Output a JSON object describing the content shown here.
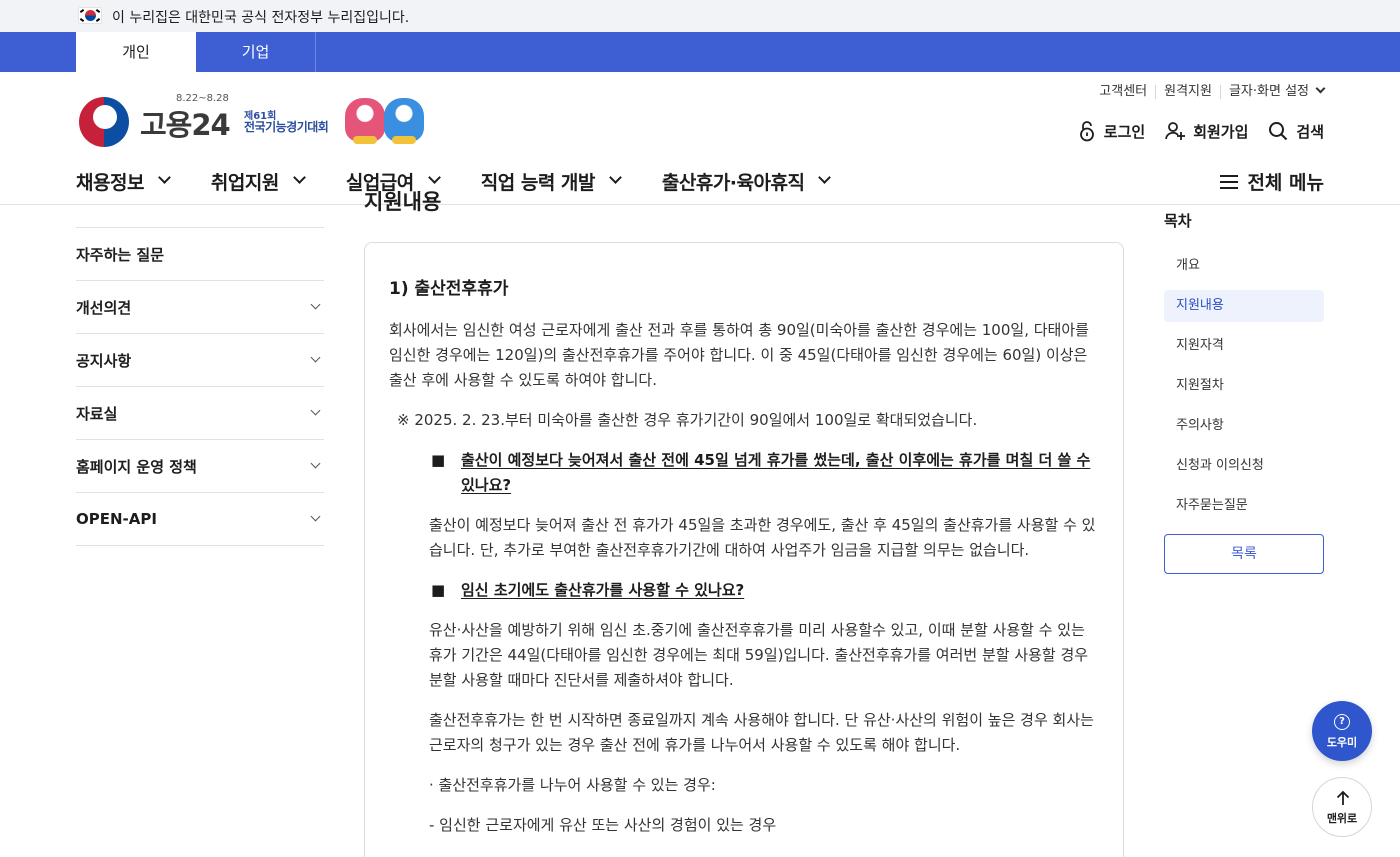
{
  "gov_banner": {
    "text": "이 누리집은 대한민국 공식 전자정부 누리집입니다."
  },
  "user_tabs": [
    {
      "label": "개인",
      "active": true
    },
    {
      "label": "기업",
      "active": false
    }
  ],
  "logo": {
    "name": "고용24",
    "date": "8.22~8.28",
    "event_line1": "제61회",
    "event_line2": "전국기능경기대회"
  },
  "util_links": [
    "고객센터",
    "원격지원",
    "글자·화면 설정"
  ],
  "member_links": {
    "login": "로그인",
    "signup": "회원가입",
    "search": "검색"
  },
  "gnb": [
    "채용정보",
    "취업지원",
    "실업급여",
    "직업 능력 개발",
    "출산휴가·육아휴직"
  ],
  "all_menu": "전체 메뉴",
  "lnb": [
    "자주하는 질문",
    "개선의견",
    "공지사항",
    "자료실",
    "홈페이지 운영 정책",
    "OPEN-API"
  ],
  "main": {
    "section_title": "지원내용",
    "sub_title": "1) 출산전후휴가",
    "intro": "회사에서는 임신한 여성 근로자에게 출산 전과 후를 통하여 총 90일(미숙아를 출산한 경우에는 100일, 다태아를 임신한 경우에는 120일)의 출산전후휴가를 주어야 합니다. 이 중 45일(다태아를 임신한 경우에는 60일) 이상은 출산 후에 사용할 수 있도록 하여야 합니다.",
    "note": "※ 2025. 2. 23.부터 미숙아를 출산한 경우 휴가기간이 90일에서 100일로 확대되었습니다.",
    "bullet": "■",
    "q1": "출산이 예정보다 늦어져서 출산 전에 45일 넘게 휴가를 썼는데, 출산 이후에는 휴가를 며칠 더 쓸 수 있나요?",
    "a1": "출산이 예정보다 늦어져 출산 전 휴가가 45일을 초과한 경우에도, 출산 후 45일의 출산휴가를 사용할 수 있습니다. 단, 추가로 부여한 출산전후휴가기간에 대하여 사업주가 임금을 지급할 의무는 없습니다.",
    "q2": "임신 초기에도 출산휴가를 사용할 수 있나요?",
    "a2": "유산·사산을 예방하기 위해 임신 초.중기에 출산전후휴가를 미리 사용할수 있고, 이때 분할 사용할 수 있는 휴가 기간은 44일(다태아를 임신한 경우에는 최대 59일)입니다. 출산전후휴가를 여러번 분할 사용할 경우 분할 사용할 때마다 진단서를 제출하셔야 합니다.",
    "a3": "출산전후휴가는 한 번 시작하면 종료일까지 계속 사용해야 합니다. 단 유산·사산의 위험이 높은 경우 회사는 근로자의 청구가 있는 경우 출산 전에 휴가를 나누어서 사용할 수 있도록 해야 합니다.",
    "list_head": "· 출산전후휴가를 나누어 사용할 수 있는 경우:",
    "list_item1": "- 임신한 근로자에게 유산 또는 사산의 경험이 있는 경우"
  },
  "toc": {
    "title": "목차",
    "items": [
      {
        "label": "개요",
        "active": false
      },
      {
        "label": "지원내용",
        "active": true
      },
      {
        "label": "지원자격",
        "active": false
      },
      {
        "label": "지원절차",
        "active": false
      },
      {
        "label": "주의사항",
        "active": false
      },
      {
        "label": "신청과 이의신청",
        "active": false
      },
      {
        "label": "자주묻는질문",
        "active": false
      }
    ],
    "list_button": "목록"
  },
  "fab": {
    "help": "도우미",
    "help_glyph": "?",
    "top": "맨위로"
  },
  "colors": {
    "primary": "#3e5fd3",
    "banner_bg": "#f1f3f6",
    "toc_active_bg": "#eef2fd"
  }
}
